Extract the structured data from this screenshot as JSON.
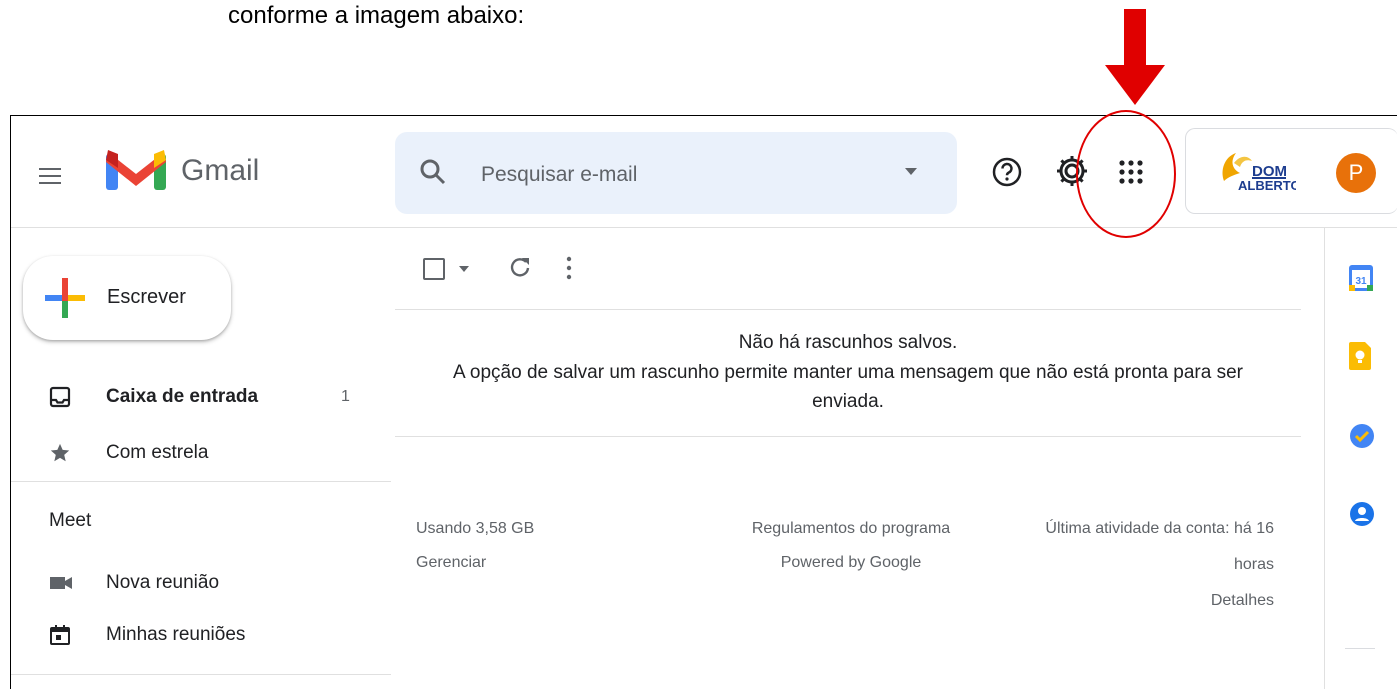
{
  "caption": "conforme a imagem abaixo:",
  "header": {
    "app_name": "Gmail",
    "search_placeholder": "Pesquisar e-mail",
    "avatar_letter": "P",
    "brand_logo_text": "DOM ALBERTO"
  },
  "sidebar": {
    "compose_label": "Escrever",
    "items": [
      {
        "label": "Caixa de entrada",
        "count": "1",
        "icon": "inbox-icon"
      },
      {
        "label": "Com estrela",
        "icon": "star-icon"
      }
    ],
    "meet": {
      "header": "Meet",
      "items": [
        {
          "label": "Nova reunião",
          "icon": "video-camera-icon"
        },
        {
          "label": "Minhas reuniões",
          "icon": "calendar-icon"
        }
      ]
    }
  },
  "main": {
    "empty_title": "Não há rascunhos salvos.",
    "empty_description": "A opção de salvar um rascunho permite manter uma mensagem que não está pronta para ser enviada.",
    "footer": {
      "storage": "Usando 3,58 GB",
      "manage": "Gerenciar",
      "program_policies": "Regulamentos do programa",
      "powered_by": "Powered by Google",
      "last_activity_line1": "Última atividade da conta: há 16",
      "last_activity_line2": "horas",
      "details": "Detalhes"
    }
  },
  "right_panel": {
    "calendar_day": "31",
    "icons": [
      "google-calendar-icon",
      "google-keep-icon",
      "google-tasks-icon",
      "google-contacts-icon"
    ]
  },
  "colors": {
    "annotation_red": "#e00000",
    "avatar": "#e8710a",
    "search_bg": "#eaf1fb"
  }
}
